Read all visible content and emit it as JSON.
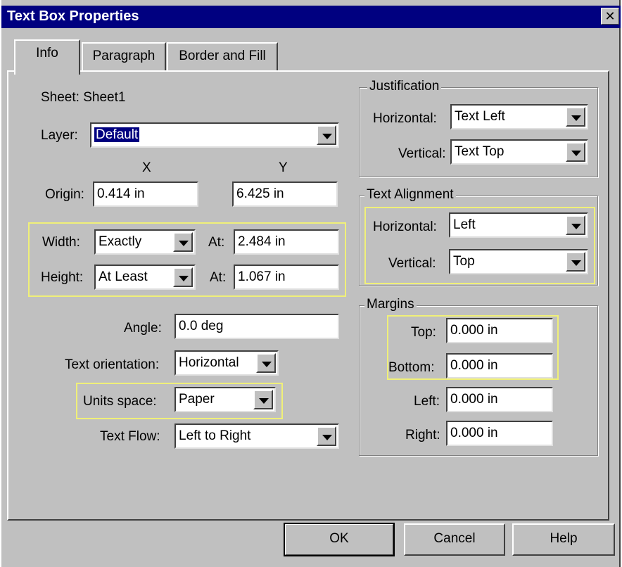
{
  "window": {
    "title": "Text Box Properties",
    "close_glyph": "✕"
  },
  "tabs": [
    {
      "label": "Info"
    },
    {
      "label": "Paragraph"
    },
    {
      "label": "Border and Fill"
    }
  ],
  "info": {
    "sheet_label": "Sheet: Sheet1",
    "layer_label": "Layer:",
    "layer_value": "Default",
    "x_header": "X",
    "y_header": "Y",
    "origin_label": "Origin:",
    "origin_x": "0.414 in",
    "origin_y": "6.425 in",
    "width_label": "Width:",
    "width_mode": "Exactly",
    "width_at_label": "At:",
    "width_value": "2.484 in",
    "height_label": "Height:",
    "height_mode": "At Least",
    "height_at_label": "At:",
    "height_value": "1.067 in",
    "angle_label": "Angle:",
    "angle_value": "0.0 deg",
    "text_orientation_label": "Text orientation:",
    "text_orientation_value": "Horizontal",
    "units_space_label": "Units space:",
    "units_space_value": "Paper",
    "text_flow_label": "Text Flow:",
    "text_flow_value": "Left to Right"
  },
  "justification": {
    "legend": "Justification",
    "horizontal_label": "Horizontal:",
    "horizontal_value": "Text Left",
    "vertical_label": "Vertical:",
    "vertical_value": "Text Top"
  },
  "text_alignment": {
    "legend": "Text Alignment",
    "horizontal_label": "Horizontal:",
    "horizontal_value": "Left",
    "vertical_label": "Vertical:",
    "vertical_value": "Top"
  },
  "margins": {
    "legend": "Margins",
    "top_label": "Top:",
    "top_value": "0.000 in",
    "bottom_label": "Bottom:",
    "bottom_value": "0.000 in",
    "left_label": "Left:",
    "left_value": "0.000 in",
    "right_label": "Right:",
    "right_value": "0.000 in"
  },
  "buttons": {
    "ok": "OK",
    "cancel": "Cancel",
    "help": "Help"
  },
  "colors": {
    "title_bar": "#000080",
    "face": "#c0c0c0",
    "highlight_box": "#f0f078"
  }
}
